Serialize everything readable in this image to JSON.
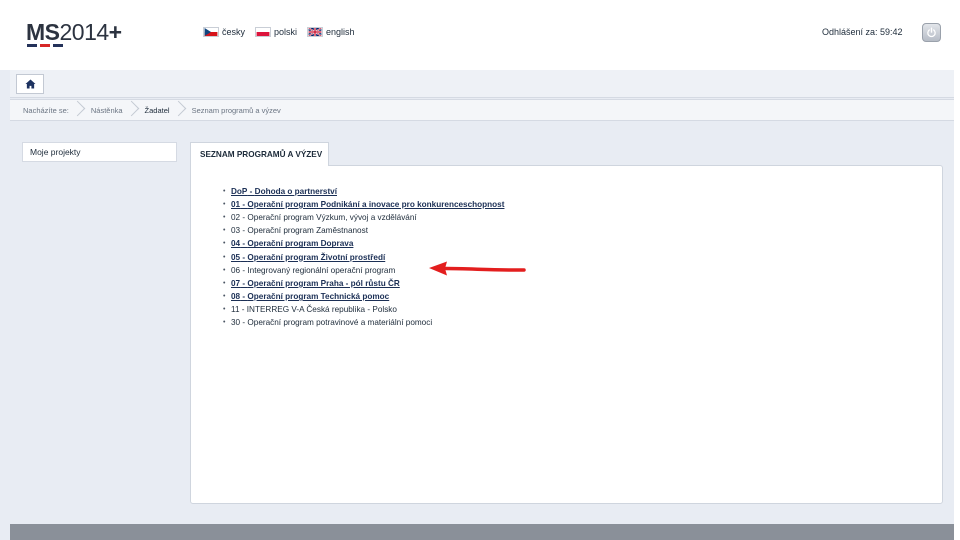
{
  "header": {
    "logo": {
      "ms": "MS",
      "year": "2014",
      "plus": "+"
    },
    "logo_bar_colors": [
      "#24325a",
      "#d62728",
      "#24325a"
    ],
    "languages": [
      {
        "label": "česky",
        "flag": "cz-flag-icon"
      },
      {
        "label": "polski",
        "flag": "pl-flag-icon"
      },
      {
        "label": "english",
        "flag": "uk-flag-icon"
      }
    ],
    "session_timer": "Odhlášení za: 59:42",
    "power_icon": "power-icon"
  },
  "navbar": {
    "home_icon": "home-icon"
  },
  "breadcrumb": {
    "prefix": "Nacházíte se:",
    "items": [
      "Nástěnka",
      "Žadatel",
      "Seznam programů a výzev"
    ]
  },
  "sidebar": {
    "items": [
      {
        "label": "Moje projekty"
      }
    ]
  },
  "main": {
    "tab_label": "SEZNAM PROGRAMŮ A VÝZEV",
    "programs": [
      {
        "code": "DoP",
        "name": "Dohoda o partnerství",
        "linked": true
      },
      {
        "code": "01",
        "name": "Operační program Podnikání a inovace pro konkurenceschopnost",
        "linked": true
      },
      {
        "code": "02",
        "name": "Operační program Výzkum, vývoj a vzdělávání",
        "linked": false
      },
      {
        "code": "03",
        "name": "Operační program Zaměstnanost",
        "linked": false
      },
      {
        "code": "04",
        "name": "Operační program Doprava",
        "linked": true
      },
      {
        "code": "05",
        "name": "Operační program Životní prostředí",
        "linked": true
      },
      {
        "code": "06",
        "name": "Integrovaný regionální operační program",
        "linked": false
      },
      {
        "code": "07",
        "name": "Operační program Praha - pól růstu ČR",
        "linked": true
      },
      {
        "code": "08",
        "name": "Operační program Technická pomoc",
        "linked": true
      },
      {
        "code": "11",
        "name": "INTERREG V-A Česká republika - Polsko",
        "linked": false
      },
      {
        "code": "30",
        "name": "Operační program potravinové a materiální pomoci",
        "linked": false
      }
    ],
    "annotation_arrow_color": "#e31e1e"
  },
  "colors": {
    "page_bg": "#e8ecf3",
    "text": "#1d2b3a",
    "link": "#1b2f55"
  }
}
